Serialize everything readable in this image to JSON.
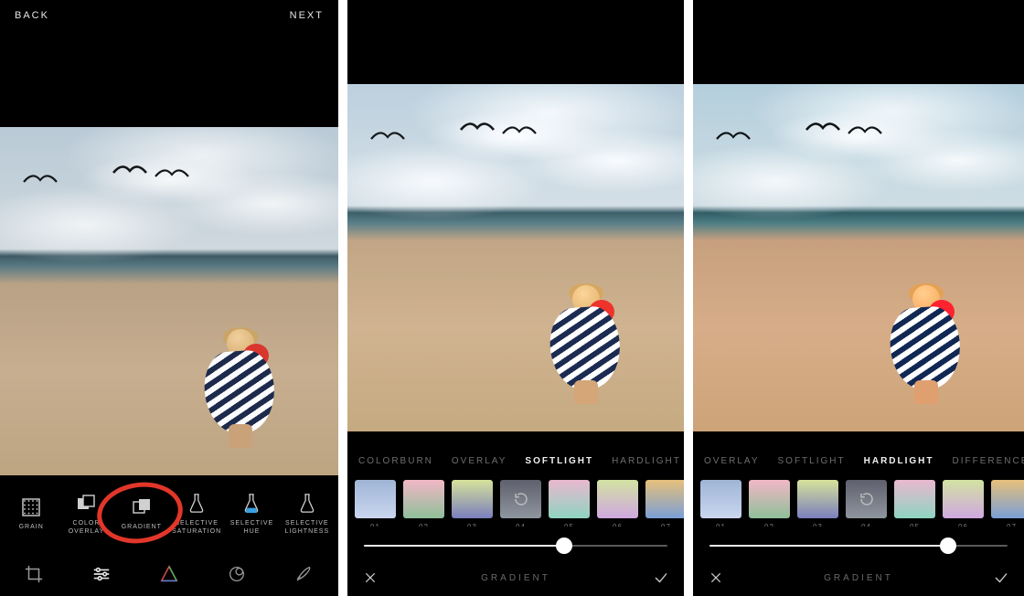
{
  "screenA": {
    "nav": {
      "back": "BACK",
      "next": "NEXT"
    },
    "tools": [
      {
        "key": "grain",
        "label": "GRAIN",
        "icon": "grain"
      },
      {
        "key": "color-overlay",
        "label": "COLOR\nOVERLAY",
        "icon": "color-overlay"
      },
      {
        "key": "gradient",
        "label": "GRADIENT",
        "icon": "gradient"
      },
      {
        "key": "selective-saturation",
        "label": "SELECTIVE\nSATURATION",
        "icon": "flask"
      },
      {
        "key": "selective-hue",
        "label": "SELECTIVE\nHUE",
        "icon": "flask-color"
      },
      {
        "key": "selective-lightness",
        "label": "SELECTIVE\nLIGHTNESS",
        "icon": "flask"
      }
    ],
    "tabs": [
      "crop",
      "adjust",
      "prism",
      "orb",
      "brush"
    ]
  },
  "screenB": {
    "modes": [
      "COLORBURN",
      "OVERLAY",
      "SOFTLIGHT",
      "HARDLIGHT"
    ],
    "active_mode": "SOFTLIGHT",
    "swatches": [
      {
        "n": "01",
        "g": [
          "#9fb5d6",
          "#c9d6ee"
        ]
      },
      {
        "n": "02",
        "g": [
          "#f2b7c6",
          "#8fbf99"
        ]
      },
      {
        "n": "03",
        "g": [
          "#d7e29a",
          "#7a7fbd"
        ]
      },
      {
        "n": "04",
        "g": [
          "#7a7c8c",
          "#b8c0cc"
        ],
        "sel": true
      },
      {
        "n": "05",
        "g": [
          "#e9b8cf",
          "#8fd4c1"
        ]
      },
      {
        "n": "06",
        "g": [
          "#d3e2a2",
          "#d0a8e0"
        ]
      },
      {
        "n": "07",
        "g": [
          "#e6c07a",
          "#7a9fd6"
        ]
      }
    ],
    "slider": 0.66,
    "title": "GRADIENT"
  },
  "screenC": {
    "modes": [
      "OVERLAY",
      "SOFTLIGHT",
      "HARDLIGHT",
      "DIFFERENCE"
    ],
    "active_mode": "HARDLIGHT",
    "swatches": [
      {
        "n": "01",
        "g": [
          "#9fb5d6",
          "#c9d6ee"
        ]
      },
      {
        "n": "02",
        "g": [
          "#f2b7c6",
          "#8fbf99"
        ]
      },
      {
        "n": "03",
        "g": [
          "#d7e29a",
          "#7a7fbd"
        ]
      },
      {
        "n": "04",
        "g": [
          "#7a7c8c",
          "#b8c0cc"
        ],
        "sel": true
      },
      {
        "n": "05",
        "g": [
          "#e9b8cf",
          "#8fd4c1"
        ]
      },
      {
        "n": "06",
        "g": [
          "#d3e2a2",
          "#d0a8e0"
        ]
      },
      {
        "n": "07",
        "g": [
          "#e6c07a",
          "#7a9fd6"
        ]
      }
    ],
    "slider": 0.8,
    "title": "GRADIENT"
  }
}
